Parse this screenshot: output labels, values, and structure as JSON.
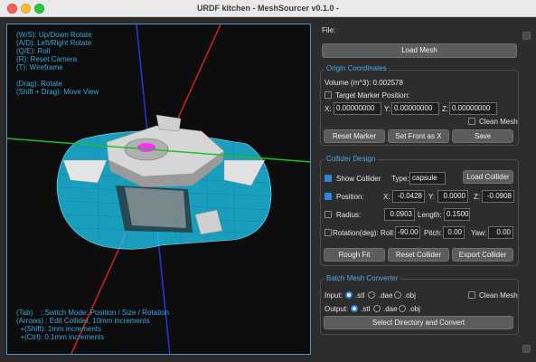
{
  "window": {
    "title": "URDF kitchen - MeshSourcer v0.1.0 -"
  },
  "viewport": {
    "help_top": "(W/S): Up/Down Rotate\n(A/D): Left/Right Rotate\n(Q/E): Roll\n(R): Reset Camera\n(T): Wireframe\n\n(Drag): Rotate\n(Shift + Drag): Move View",
    "help_bottom": "(Tab)    : Switch Mode: Position / Size / Rotation\n(Arrows) : Edit Collider, 10mm increments\n  +(Shift): 1mm increments\n  +(Ctrl): 0.1mm increments"
  },
  "panel": {
    "file_label": "File:",
    "load_mesh": "Load Mesh",
    "origin": {
      "title": "Origin Coordinates",
      "volume_label": "Volume (m^3): 0.002578",
      "target_marker_label": "Target Marker Position:",
      "x_label": "X:",
      "x_value": "0.00000000",
      "y_label": "Y:",
      "y_value": "0.00000000",
      "z_label": "Z:",
      "z_value": "0.00000000",
      "clean_mesh": "Clean Mesh",
      "reset_marker": "Reset Marker",
      "set_front": "Set Front as X",
      "save": "Save"
    },
    "collider": {
      "title": "Collider Design",
      "show_collider": "Show Collider",
      "type_label": "Type:",
      "type_value": "capsule",
      "load_collider": "Load Collider",
      "position_label": "Position:",
      "px_label": "X:",
      "px_value": "-0.0428",
      "py_label": "Y:",
      "py_value": "0.0000",
      "pz_label": "Z:",
      "pz_value": "-0.0908",
      "radius_label": "Radius:",
      "radius_value": "0.0903",
      "length_label": "Length:",
      "length_value": "0.1500",
      "rotation_label": "Rotation(deg):",
      "roll_label": "Roll:",
      "roll_value": "-90.00",
      "pitch_label": "Pitch:",
      "pitch_value": "0.00",
      "yaw_label": "Yaw:",
      "yaw_value": "0.00",
      "rough_fit": "Rough Fit",
      "reset_collider": "Reset Collider",
      "export_collider": "Export Collider"
    },
    "batch": {
      "title": "Batch Mesh Converter",
      "input_label": "Input:",
      "output_label": "Output:",
      "opt_stl": ".stl",
      "opt_dae": ".dae",
      "opt_obj": ".obj",
      "clean_mesh": "Clean Mesh",
      "select_convert": "Select Directory and Convert"
    }
  },
  "colors": {
    "accent": "#2f86dc",
    "help_text": "#3ea6dc",
    "mesh_cyan": "#1ec8f0",
    "axis_red": "#d42020",
    "axis_green": "#20c020",
    "axis_blue": "#2a34e0",
    "marker_magenta": "#ff2dff"
  }
}
